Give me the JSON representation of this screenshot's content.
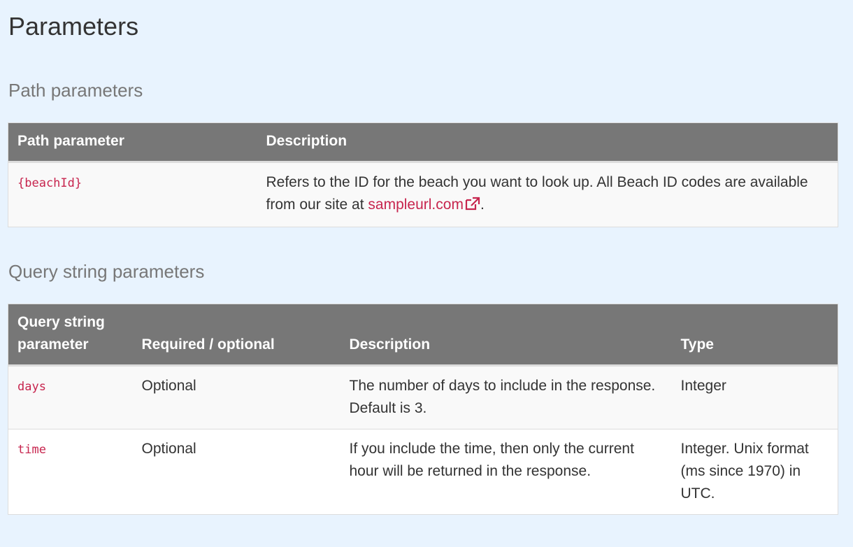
{
  "page_title": "Parameters",
  "path_section": {
    "heading": "Path parameters",
    "columns": [
      "Path parameter",
      "Description"
    ],
    "rows": [
      {
        "name": "{beachId}",
        "description_prefix": "Refers to the ID for the beach you want to look up. All Beach ID codes are available from our site at ",
        "link_text": "sampleurl.com",
        "link_icon": "external-link-icon",
        "description_suffix": "."
      }
    ]
  },
  "query_section": {
    "heading": "Query string parameters",
    "columns": [
      "Query string parameter",
      "Required / optional",
      "Description",
      "Type"
    ],
    "rows": [
      {
        "name": "days",
        "required": "Optional",
        "description": "The number of days to include in the response. Default is 3.",
        "type": "Integer"
      },
      {
        "name": "time",
        "required": "Optional",
        "description": "If you include the time, then only the current hour will be returned in the response.",
        "type": "Integer. Unix format (ms since 1970) in UTC."
      }
    ]
  },
  "colors": {
    "background": "#e8f3fe",
    "header_bg": "#777777",
    "code_color": "#c7254e",
    "link_color": "#c7254e"
  }
}
